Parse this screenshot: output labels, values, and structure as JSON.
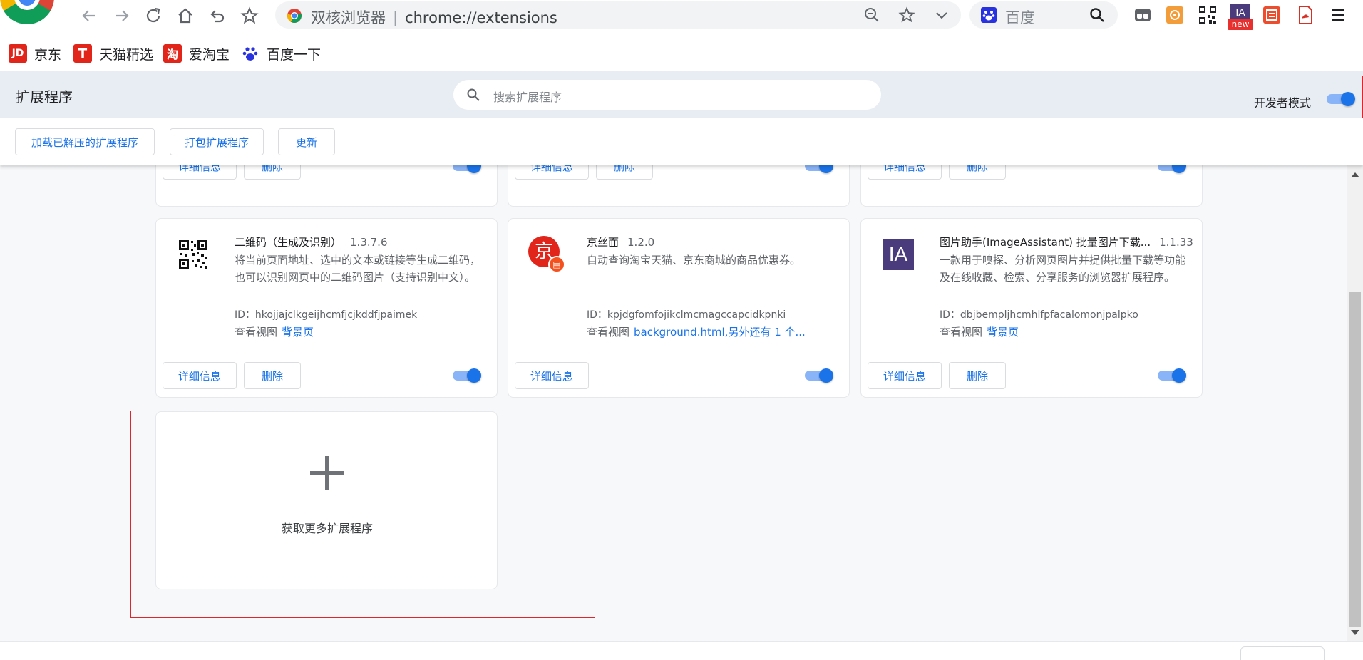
{
  "browser": {
    "title": "双核浏览器",
    "url": "chrome://extensions",
    "search_placeholder": "百度",
    "badge_new": "new"
  },
  "bookmarks": [
    {
      "label": "京东",
      "icon": "jd-icon",
      "color": "#e1251b"
    },
    {
      "label": "天猫精选",
      "icon": "tmall-icon",
      "color": "#e1251b"
    },
    {
      "label": "爱淘宝",
      "icon": "taobao-icon",
      "color": "#e1251b"
    },
    {
      "label": "百度一下",
      "icon": "baidu-icon",
      "color": "#2932e1"
    }
  ],
  "extensions_header": {
    "title": "扩展程序",
    "search_placeholder": "搜索扩展程序",
    "dev_mode_label": "开发者模式",
    "dev_mode_on": true
  },
  "action_bar": {
    "load_unpacked": "加载已解压的扩展程序",
    "pack": "打包扩展程序",
    "update": "更新"
  },
  "card_buttons": {
    "details": "详细信息",
    "remove": "删除"
  },
  "extensions": [
    {
      "name": "二维码（生成及识别）",
      "version": "1.3.7.6",
      "description": "将当前页面地址、选中的文本或链接等生成二维码，也可以识别网页中的二维码图片（支持识别中文）。",
      "id_label": "ID：",
      "id": "hkojjajclkgeijhcmfjcjkddfjpaimek",
      "views_label": "查看视图",
      "views_link": "背景页",
      "enabled": true
    },
    {
      "name": "京丝面",
      "version": "1.2.0",
      "description": "自动查询淘宝天猫、京东商城的商品优惠券。",
      "id_label": "ID：",
      "id": "kpjdgfomfojikclmcmagccapcidkpnki",
      "views_label": "查看视图",
      "views_link": "background.html,另外还有 1 个...",
      "enabled": true
    },
    {
      "name": "图片助手(ImageAssistant) 批量图片下载...",
      "version": "1.1.33",
      "description": "一款用于嗅探、分析网页图片并提供批量下载等功能及在线收藏、检索、分享服务的浏览器扩展程序。",
      "id_label": "ID：",
      "id": "dbjbempljhcmhlfpfacalomonjpalpko",
      "views_label": "查看视图",
      "views_link": "背景页",
      "enabled": true
    }
  ],
  "more_extensions": {
    "label": "获取更多扩展程序"
  },
  "colors": {
    "accent": "#1a73e8",
    "highlight_box": "#e0242b"
  }
}
